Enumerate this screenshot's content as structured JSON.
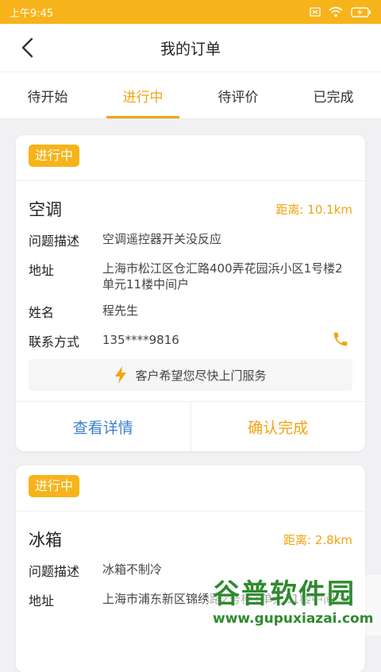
{
  "status_bar": {
    "time": "上午9:45"
  },
  "header": {
    "title": "我的订单"
  },
  "tabs": [
    {
      "label": "待开始"
    },
    {
      "label": "进行中"
    },
    {
      "label": "待评价"
    },
    {
      "label": "已完成"
    }
  ],
  "active_tab_index": 1,
  "orders": [
    {
      "status": "进行中",
      "device": "空调",
      "distance": "距离: 10.1km",
      "problem_label": "问题描述",
      "problem": "空调遥控器开关没反应",
      "address_label": "地址",
      "address": "上海市松江区仓汇路400弄花园浜小区1号楼2单元11楼中间户",
      "name_label": "姓名",
      "name": "程先生",
      "contact_label": "联系方式",
      "contact": "135****9816",
      "hint": "客户希望您尽快上门服务",
      "details_button": "查看详情",
      "confirm_button": "确认完成"
    },
    {
      "status": "进行中",
      "device": "冰箱",
      "distance": "距离: 2.8km",
      "problem_label": "问题描述",
      "problem": "冰箱不制冷",
      "address_label": "地址",
      "address": "上海市浦东新区锦绣路2号楼1单元11楼中间户"
    }
  ],
  "watermark": {
    "title": "谷普软件园",
    "url": "www.gupuxiazai.com"
  },
  "colors": {
    "accent": "#f7b31a",
    "link_blue": "#3d7fcf"
  }
}
